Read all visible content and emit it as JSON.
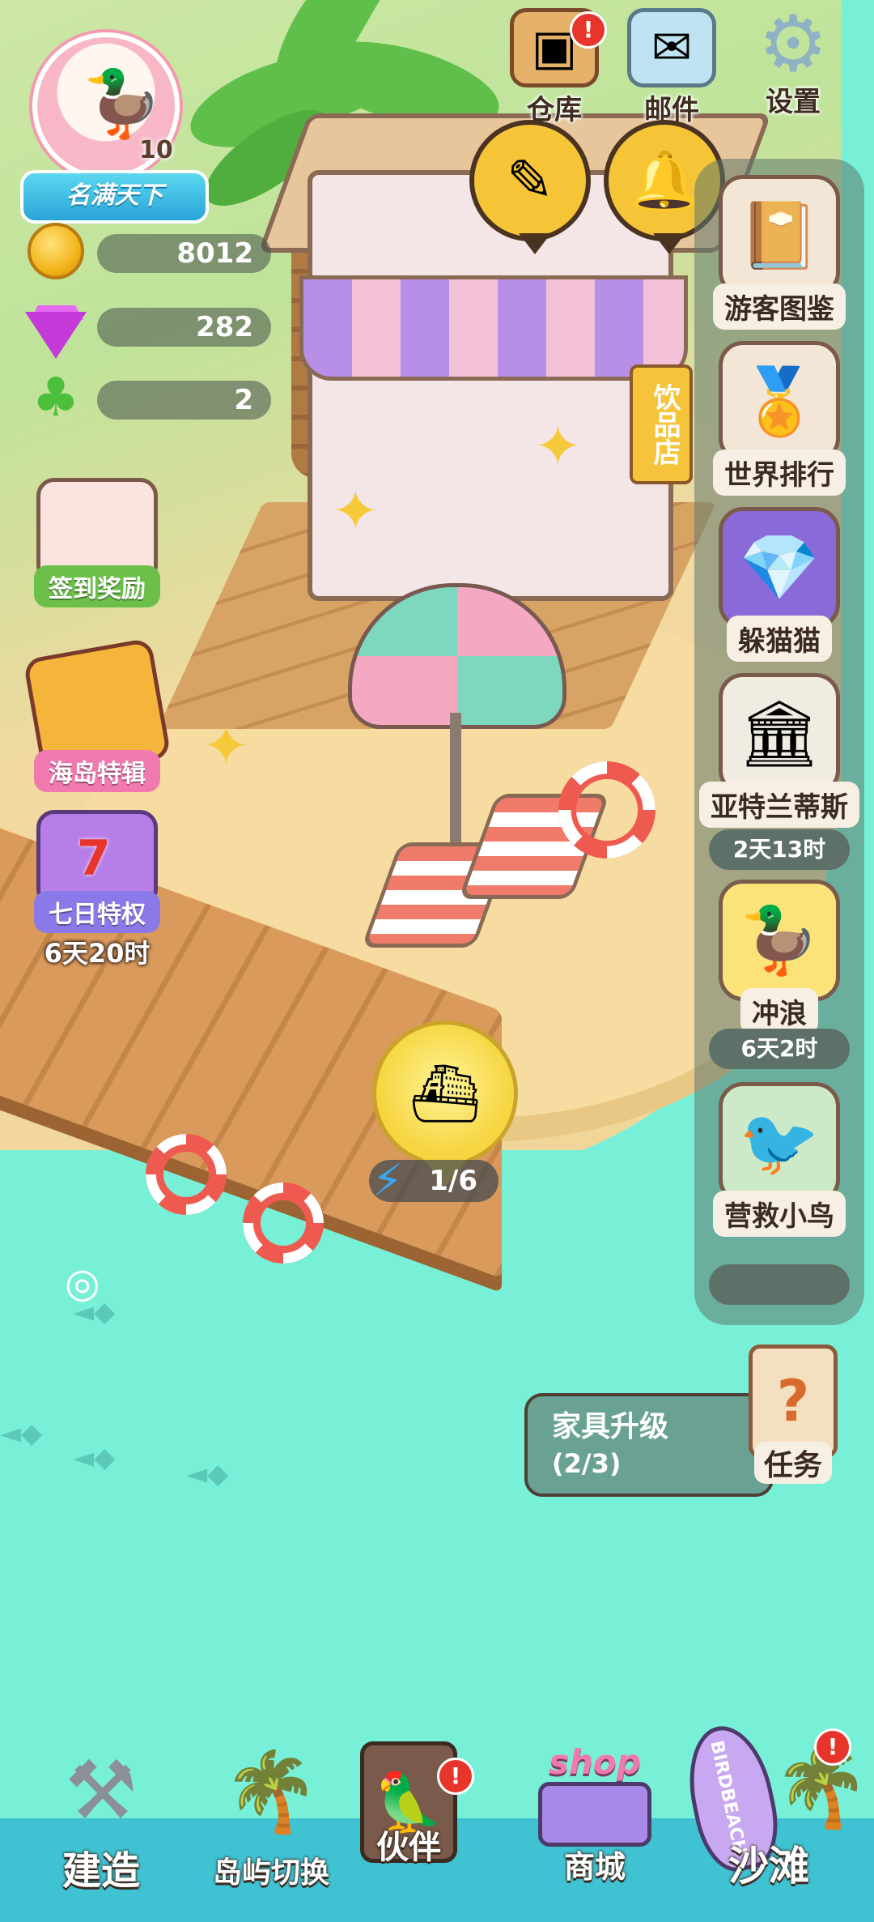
{
  "player": {
    "level": "10级",
    "title_banner": "名满天下"
  },
  "resources": {
    "coins": "8012",
    "gems": "282",
    "clovers": "2"
  },
  "top_menu": [
    {
      "label": "仓库",
      "icon": "warehouse-icon",
      "badge": "!"
    },
    {
      "label": "邮件",
      "icon": "mail-icon"
    },
    {
      "label": "设置",
      "icon": "gear-icon"
    }
  ],
  "left_events": {
    "checkin": {
      "label": "签到奖励"
    },
    "island_special": {
      "label": "海岛特辑"
    },
    "seven_day": {
      "label": "七日特权",
      "badge_number": "7",
      "timer": "6天20时"
    }
  },
  "right_panel": {
    "guest_guide": {
      "label": "游客图鉴"
    },
    "world_rank": {
      "label": "世界排行"
    },
    "hide_and_seek": {
      "label": "躲猫猫"
    },
    "atlantis": {
      "label": "亚特兰蒂斯",
      "timer": "2天13时"
    },
    "surf": {
      "label": "冲浪",
      "timer": "6天2时"
    },
    "rescue_bird": {
      "label": "营救小鸟"
    }
  },
  "shop_sign": "饮品店",
  "ferry": {
    "count": "1/6"
  },
  "quest": {
    "title": "家具升级",
    "progress": "(2/3)",
    "button_label": "任务"
  },
  "bottom_nav": [
    {
      "label": "建造",
      "icon": "hammer-wrench-icon"
    },
    {
      "label": "岛屿切换",
      "icon": "island-icon"
    },
    {
      "label": "伙伴",
      "icon": "partner-card-icon",
      "badge": "!"
    },
    {
      "label": "商城",
      "icon": "shop-icon",
      "art_text": "shop"
    },
    {
      "label": "沙滩",
      "icon": "surfboard-palm-icon",
      "art_text": "BIRDBEACH",
      "badge": "!"
    }
  ],
  "colors": {
    "water": "#78f0d8",
    "coin": "#f3b51c",
    "gem": "#c33ad8",
    "clover": "#4cbf3c",
    "alert_red": "#e8352b",
    "bubble_yellow": "#f6c437",
    "nav_strip": "#3fc2d2"
  }
}
